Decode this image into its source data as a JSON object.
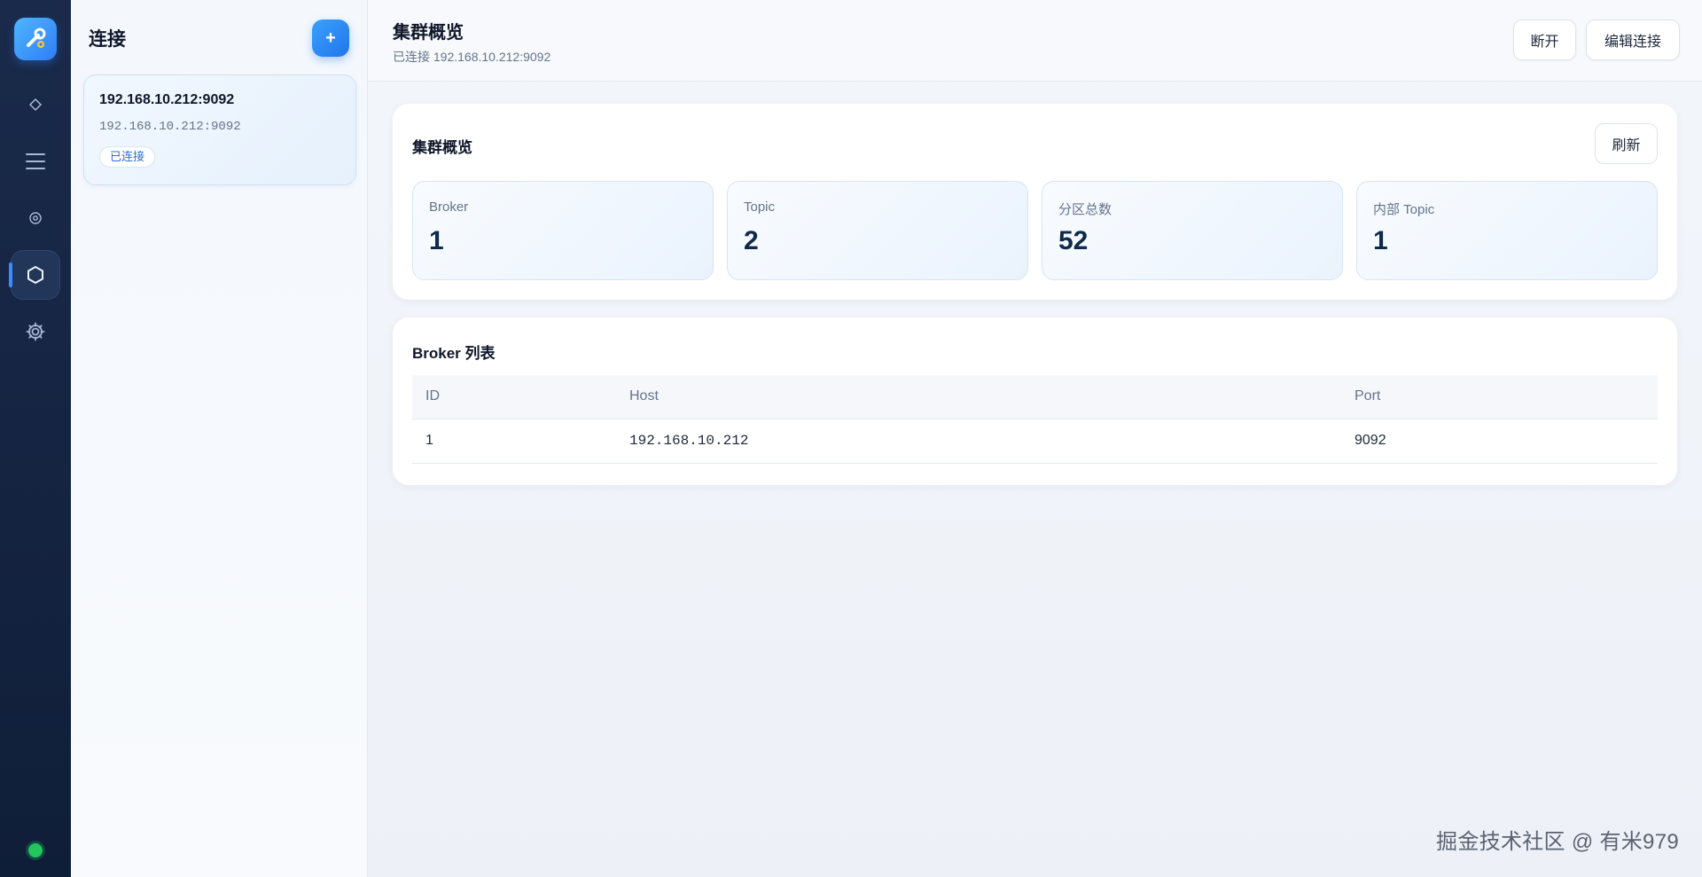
{
  "rail": {
    "icons": [
      "app-logo",
      "diamond-icon",
      "menu-icon",
      "target-icon",
      "hexagon-icon",
      "gear-icon"
    ]
  },
  "connections": {
    "title": "连接",
    "add_label": "+",
    "items": [
      {
        "name": "192.168.10.212:9092",
        "address": "192.168.10.212:9092",
        "status": "已连接"
      }
    ]
  },
  "header": {
    "title": "集群概览",
    "subtitle": "已连接 192.168.10.212:9092",
    "disconnect_label": "断开",
    "edit_label": "编辑连接"
  },
  "overview": {
    "title": "集群概览",
    "refresh_label": "刷新",
    "stats": [
      {
        "label": "Broker",
        "value": "1"
      },
      {
        "label": "Topic",
        "value": "2"
      },
      {
        "label": "分区总数",
        "value": "52"
      },
      {
        "label": "内部 Topic",
        "value": "1"
      }
    ]
  },
  "brokers": {
    "title": "Broker 列表",
    "columns": [
      "ID",
      "Host",
      "Port"
    ],
    "rows": [
      {
        "id": "1",
        "host": "192.168.10.212",
        "port": "9092"
      }
    ]
  },
  "watermark": "掘金技术社区 @ 有米979",
  "colors": {
    "rail_bg": "#142340",
    "accent": "#2f7df4",
    "status_ok": "#22c55e"
  }
}
